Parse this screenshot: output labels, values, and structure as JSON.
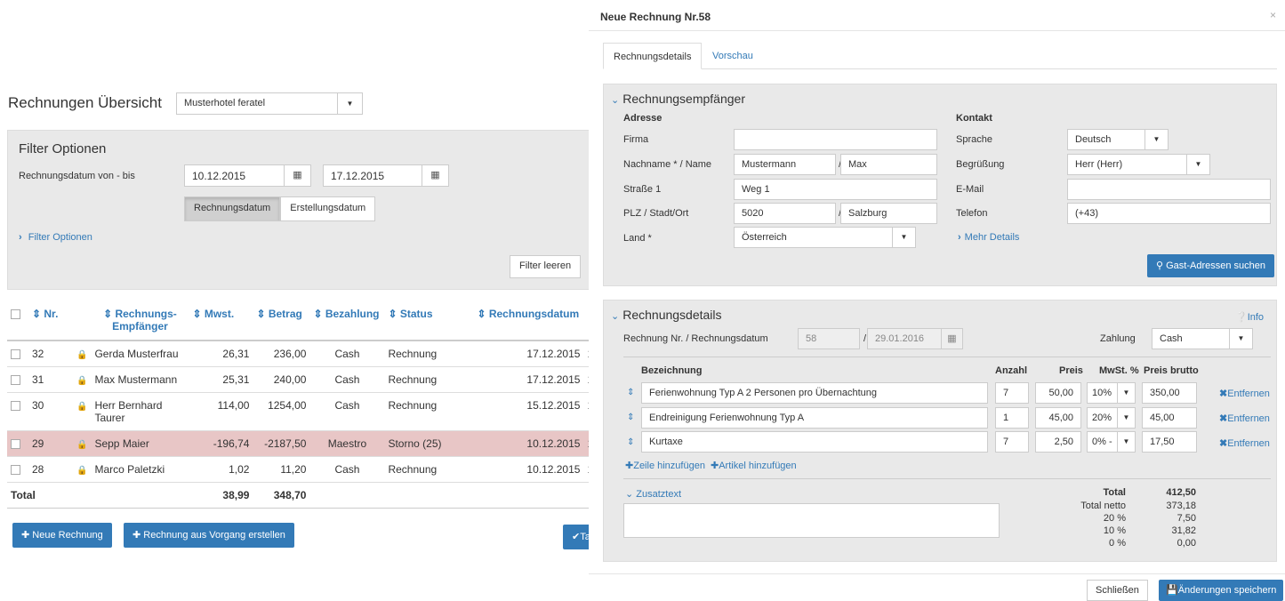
{
  "overview": {
    "title": "Rechnungen Übersicht",
    "hotel_select": "Musterhotel feratel",
    "filter": {
      "title": "Filter Optionen",
      "date_label": "Rechnungsdatum von - bis",
      "date_from": "10.12.2015",
      "date_to": "17.12.2015",
      "toggle_invoice_date": "Rechnungsdatum",
      "toggle_created_date": "Erstellungsdatum",
      "more_link": "Filter Optionen",
      "clear_button": "Filter leeren"
    },
    "table": {
      "headers": [
        "Nr.",
        "Rechnungs-Empfänger",
        "Mwst.",
        "Betrag",
        "Bezahlung",
        "Status",
        "Rechnungsdatum"
      ],
      "rows": [
        {
          "nr": "32",
          "recipient": "Gerda Musterfrau",
          "tax": "26,31",
          "amount": "236,00",
          "payment": "Cash",
          "status": "Rechnung",
          "date": "17.12.2015",
          "extra": "1"
        },
        {
          "nr": "31",
          "recipient": "Max Mustermann",
          "tax": "25,31",
          "amount": "240,00",
          "payment": "Cash",
          "status": "Rechnung",
          "date": "17.12.2015",
          "extra": "1"
        },
        {
          "nr": "30",
          "recipient": "Herr Bernhard Taurer",
          "tax": "114,00",
          "amount": "1254,00",
          "payment": "Cash",
          "status": "Rechnung",
          "date": "15.12.2015",
          "extra": "1"
        },
        {
          "nr": "29",
          "recipient": "Sepp Maier",
          "tax": "-196,74",
          "amount": "-2187,50",
          "payment": "Maestro",
          "status": "Storno (25)",
          "date": "10.12.2015",
          "extra": "1"
        },
        {
          "nr": "28",
          "recipient": "Marco Paletzki",
          "tax": "1,02",
          "amount": "11,20",
          "payment": "Cash",
          "status": "Rechnung",
          "date": "10.12.2015",
          "extra": "1"
        }
      ],
      "total_label": "Total",
      "total_tax": "38,99",
      "total_amount": "348,70"
    },
    "buttons": {
      "new_invoice": "Neue Rechnung",
      "from_process": "Rechnung aus Vorgang erstellen",
      "edge": "Ta"
    }
  },
  "modal": {
    "title": "Neue Rechnung Nr.58",
    "close": "×",
    "tabs": [
      "Rechnungsdetails",
      "Vorschau"
    ],
    "recipient": {
      "heading": "Rechnungsempfänger",
      "address_title": "Adresse",
      "contact_title": "Kontakt",
      "company_label": "Firma",
      "company_value": "",
      "name_label": "Nachname * / Name",
      "last_name": "Mustermann",
      "first_name": "Max",
      "street_label": "Straße 1",
      "street": "Weg 1",
      "zip_label": "PLZ / Stadt/Ort",
      "zip": "5020",
      "city": "Salzburg",
      "country_label": "Land *",
      "country": "Österreich",
      "language_label": "Sprache",
      "language": "Deutsch",
      "greeting_label": "Begrüßung",
      "greeting": "Herr (Herr)",
      "email_label": "E-Mail",
      "email": "",
      "phone_label": "Telefon",
      "phone": "(+43)",
      "more_details": "Mehr Details",
      "search_button": "Gast-Adressen suchen"
    },
    "details": {
      "heading": "Rechnungsdetails",
      "info": "Info",
      "number_label": "Rechnung Nr. / Rechnungsdatum",
      "number": "58",
      "date": "29.01.2016",
      "payment_label": "Zahlung",
      "payment": "Cash",
      "col_desc": "Bezeichnung",
      "col_qty": "Anzahl",
      "col_price": "Preis",
      "col_tax": "MwSt. %",
      "col_gross": "Preis brutto",
      "lines": [
        {
          "desc": "Ferienwohnung Typ A 2 Personen  pro Übernachtung",
          "qty": "7",
          "price": "50,00",
          "tax": "10%",
          "gross": "350,00",
          "remove": "Entfernen"
        },
        {
          "desc": "Endreinigung Ferienwohnung Typ A",
          "qty": "1",
          "price": "45,00",
          "tax": "20%",
          "gross": "45,00",
          "remove": "Entfernen"
        },
        {
          "desc": "Kurtaxe",
          "qty": "7",
          "price": "2,50",
          "tax": "0% -",
          "gross": "17,50",
          "remove": "Entfernen"
        }
      ],
      "add_line": "Zeile hinzufügen",
      "add_article": "Artikel hinzufügen",
      "extra_text": "Zusatztext",
      "summary": [
        {
          "label": "Total",
          "value": "412,50"
        },
        {
          "label": "Total netto",
          "value": "373,18"
        },
        {
          "label": "20 %",
          "value": "7,50"
        },
        {
          "label": "10 %",
          "value": "31,82"
        },
        {
          "label": "0 %",
          "value": "0,00"
        }
      ]
    },
    "footer": {
      "close": "Schließen",
      "save": "Änderungen speichern"
    }
  }
}
